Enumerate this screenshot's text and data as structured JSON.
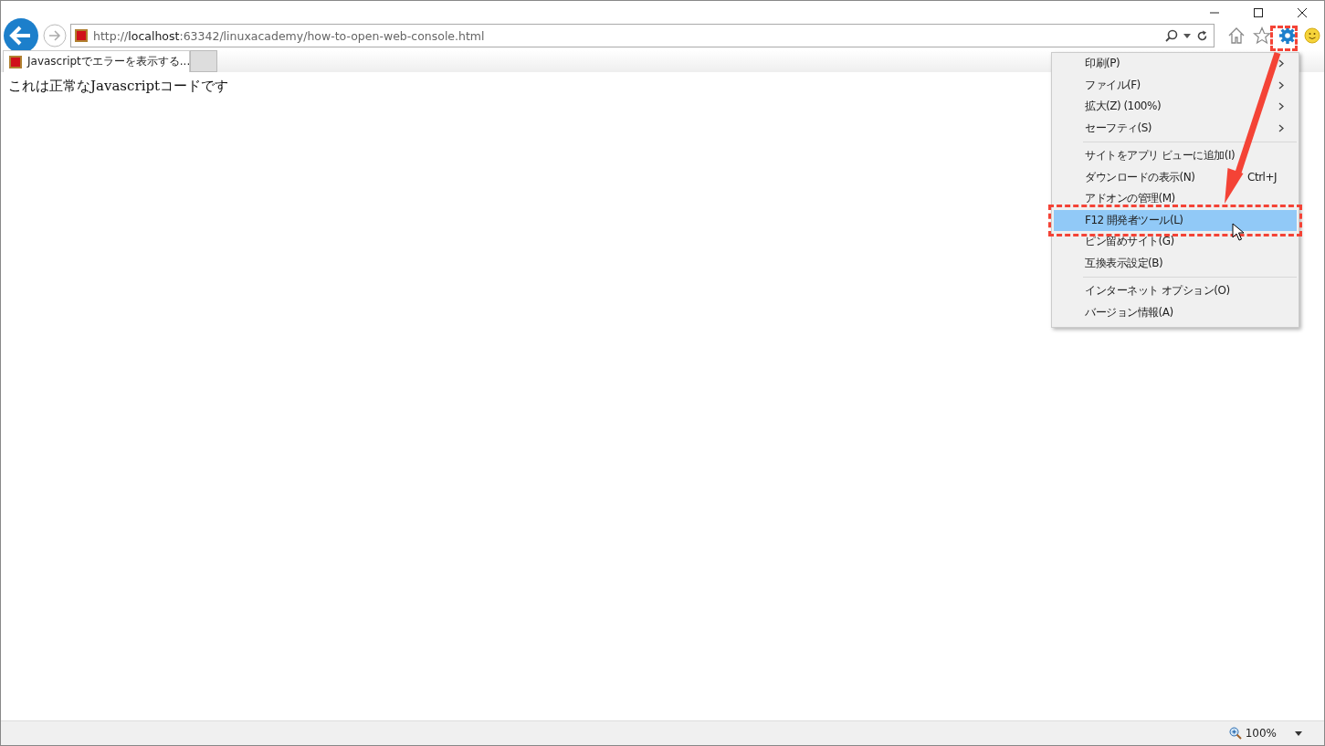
{
  "address_bar": {
    "url_prefix": "http://",
    "url_host": "localhost",
    "url_rest": ":63342/linuxacademy/how-to-open-web-console.html"
  },
  "tabs": [
    {
      "label": "Javascriptでエラーを表示する...",
      "selected": true
    }
  ],
  "page": {
    "text": "これは正常なJavascriptコードです"
  },
  "menu": {
    "groups": [
      [
        {
          "label": "印刷(P)",
          "submenu": true,
          "selected": false
        },
        {
          "label": "ファイル(F)",
          "submenu": true,
          "selected": false
        },
        {
          "label": "拡大(Z) (100%)",
          "submenu": true,
          "selected": false
        },
        {
          "label": "セーフティ(S)",
          "submenu": true,
          "selected": false
        }
      ],
      [
        {
          "label": "サイトをアプリ ビューに追加(I)",
          "submenu": false,
          "selected": false
        },
        {
          "label": "ダウンロードの表示(N)",
          "shortcut": "Ctrl+J",
          "submenu": false,
          "selected": false
        },
        {
          "label": "アドオンの管理(M)",
          "submenu": false,
          "selected": false
        },
        {
          "label": "F12 開発者ツール(L)",
          "submenu": false,
          "selected": true
        },
        {
          "label": "ピン留めサイト(G)",
          "submenu": false,
          "selected": false
        },
        {
          "label": "互換表示設定(B)",
          "submenu": false,
          "selected": false
        }
      ],
      [
        {
          "label": "インターネット オプション(O)",
          "submenu": false,
          "selected": false
        },
        {
          "label": "バージョン情報(A)",
          "submenu": false,
          "selected": false
        }
      ]
    ]
  },
  "status_bar": {
    "zoom": "100%"
  }
}
